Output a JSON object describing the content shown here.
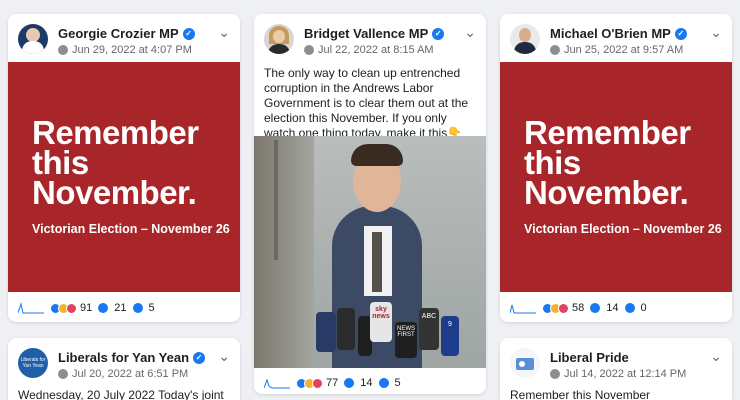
{
  "posts": [
    {
      "author": "Georgie Crozier MP",
      "date": "Jun 29, 2022 at 4:07 PM",
      "headline": [
        "Remember",
        "this",
        "November."
      ],
      "subline": "Victorian Election – November 26",
      "reactions": "91",
      "comments": "21",
      "shares": "5"
    },
    {
      "author": "Bridget Vallence MP",
      "date": "Jul 22, 2022 at 8:15 AM",
      "text": "The only way to clean up entrenched corruption in the Andrews Labor Government is to clear them out at the election this November. If you only watch one thing today, make it this👇",
      "mic_labels": [
        "sky news",
        "NEWS FIRST",
        "ABC",
        "9"
      ],
      "reactions": "77",
      "comments": "14",
      "shares": "5"
    },
    {
      "author": "Michael O'Brien MP",
      "date": "Jun 25, 2022 at 9:57 AM",
      "headline": [
        "Remember",
        "this",
        "November."
      ],
      "subline": "Victorian Election – November 26",
      "reactions": "58",
      "comments": "14",
      "shares": "0"
    },
    {
      "author": "Liberals for Yan Yean",
      "avatar_text": "Liberals for Yan Yean",
      "date": "Jul 20, 2022 at 6:51 PM",
      "text": "Wednesday, 20 July 2022 Today's joint"
    },
    {
      "author": "Liberal Pride",
      "date": "Jul 14, 2022 at 12:14 PM",
      "text": "Remember this November #RebuildRecover"
    }
  ],
  "colors": {
    "red": "#a8262a",
    "blue": "#1877f2"
  }
}
